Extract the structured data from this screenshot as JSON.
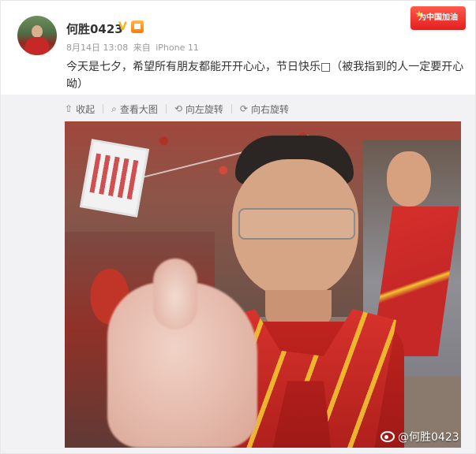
{
  "post": {
    "username": "何胜0423",
    "date": "8月14日 13:08",
    "source_prefix": "来自",
    "source": "iPhone 11",
    "text": "今天是七夕，希望所有朋友都能开开心心，节日快乐□（被我指到的人一定要开心呦）",
    "campaign_badge": "为中国加油"
  },
  "toolbar": {
    "collapse": "收起",
    "view_large": "查看大图",
    "rotate_left": "向左旋转",
    "rotate_right": "向右旋转"
  },
  "photo": {
    "watermark": "@何胜0423"
  },
  "icons": {
    "collapse": "arrow-up-icon",
    "view_large": "magnify-icon",
    "rotate_left": "rotate-left-icon",
    "rotate_right": "rotate-right-icon",
    "verified": "verified-v-icon",
    "vip": "vip-badge-icon",
    "weibo": "weibo-logo-icon"
  },
  "colors": {
    "verified": "#f3b617",
    "badge_red": "#e21f1f",
    "meta_gray": "#999999",
    "toolbar_bg": "#f2f2f5"
  }
}
